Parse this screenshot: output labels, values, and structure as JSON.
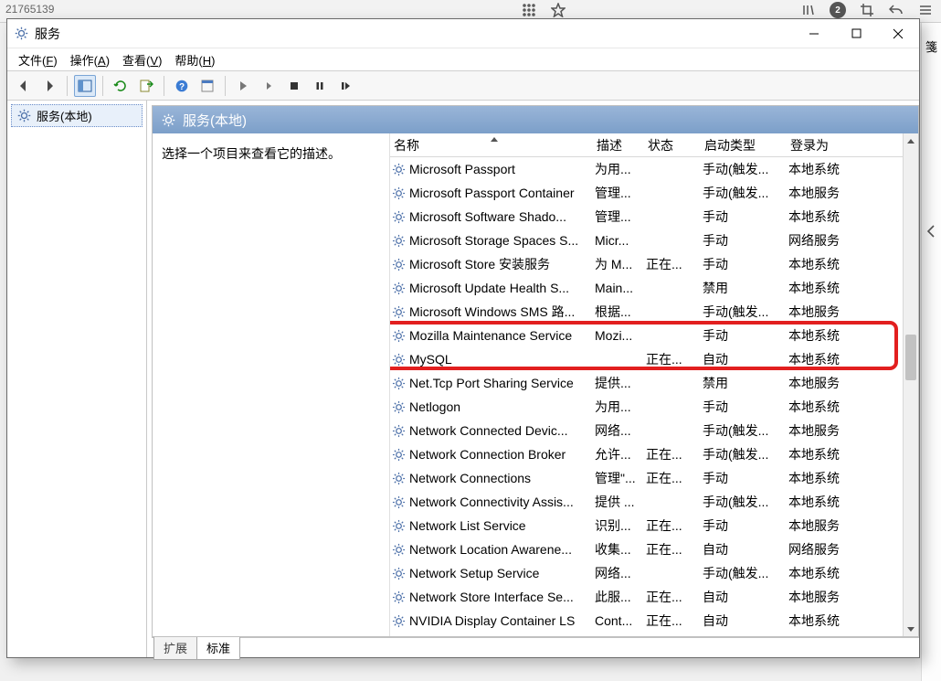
{
  "browser_bg": {
    "address_fragment": "21765139",
    "toolbar_icons": [
      "grid-icon",
      "star-icon",
      "library-icon",
      "badge-2",
      "crop-icon",
      "undo-icon",
      "menu-icon"
    ],
    "badge_value": "2",
    "right_strip": {
      "bookmark_glyph": "箋",
      "chevron": "‹"
    }
  },
  "window": {
    "title": "服务",
    "controls": {
      "min": "—",
      "max": "□",
      "close": "×"
    }
  },
  "menubar": [
    {
      "label": "文件",
      "hotkey": "F"
    },
    {
      "label": "操作",
      "hotkey": "A"
    },
    {
      "label": "查看",
      "hotkey": "V"
    },
    {
      "label": "帮助",
      "hotkey": "H"
    }
  ],
  "tree": {
    "root": "服务(本地)"
  },
  "content": {
    "header": "服务(本地)",
    "desc_prompt": "选择一个项目来查看它的描述。"
  },
  "columns": {
    "name": "名称",
    "desc": "描述",
    "status": "状态",
    "startup": "启动类型",
    "logon": "登录为"
  },
  "services": [
    {
      "name": "Microsoft Passport",
      "desc": "为用...",
      "status": "",
      "startup": "手动(触发...",
      "logon": "本地系统"
    },
    {
      "name": "Microsoft Passport Container",
      "desc": "管理...",
      "status": "",
      "startup": "手动(触发...",
      "logon": "本地服务"
    },
    {
      "name": "Microsoft Software Shado...",
      "desc": "管理...",
      "status": "",
      "startup": "手动",
      "logon": "本地系统"
    },
    {
      "name": "Microsoft Storage Spaces S...",
      "desc": "Micr...",
      "status": "",
      "startup": "手动",
      "logon": "网络服务"
    },
    {
      "name": "Microsoft Store 安装服务",
      "desc": "为 M...",
      "status": "正在...",
      "startup": "手动",
      "logon": "本地系统"
    },
    {
      "name": "Microsoft Update Health S...",
      "desc": "Main...",
      "status": "",
      "startup": "禁用",
      "logon": "本地系统"
    },
    {
      "name": "Microsoft Windows SMS 路...",
      "desc": "根据...",
      "status": "",
      "startup": "手动(触发...",
      "logon": "本地服务"
    },
    {
      "name": "Mozilla Maintenance Service",
      "desc": "Mozi...",
      "status": "",
      "startup": "手动",
      "logon": "本地系统"
    },
    {
      "name": "MySQL",
      "desc": "",
      "status": "正在...",
      "startup": "自动",
      "logon": "本地系统"
    },
    {
      "name": "Net.Tcp Port Sharing Service",
      "desc": "提供...",
      "status": "",
      "startup": "禁用",
      "logon": "本地服务"
    },
    {
      "name": "Netlogon",
      "desc": "为用...",
      "status": "",
      "startup": "手动",
      "logon": "本地系统"
    },
    {
      "name": "Network Connected Devic...",
      "desc": "网络...",
      "status": "",
      "startup": "手动(触发...",
      "logon": "本地服务"
    },
    {
      "name": "Network Connection Broker",
      "desc": "允许...",
      "status": "正在...",
      "startup": "手动(触发...",
      "logon": "本地系统"
    },
    {
      "name": "Network Connections",
      "desc": "管理\"...",
      "status": "正在...",
      "startup": "手动",
      "logon": "本地系统"
    },
    {
      "name": "Network Connectivity Assis...",
      "desc": "提供 ...",
      "status": "",
      "startup": "手动(触发...",
      "logon": "本地系统"
    },
    {
      "name": "Network List Service",
      "desc": "识别...",
      "status": "正在...",
      "startup": "手动",
      "logon": "本地服务"
    },
    {
      "name": "Network Location Awarene...",
      "desc": "收集...",
      "status": "正在...",
      "startup": "自动",
      "logon": "网络服务"
    },
    {
      "name": "Network Setup Service",
      "desc": "网络...",
      "status": "",
      "startup": "手动(触发...",
      "logon": "本地系统"
    },
    {
      "name": "Network Store Interface Se...",
      "desc": "此服...",
      "status": "正在...",
      "startup": "自动",
      "logon": "本地服务"
    },
    {
      "name": "NVIDIA Display Container LS",
      "desc": "Cont...",
      "status": "正在...",
      "startup": "自动",
      "logon": "本地系统"
    }
  ],
  "tabs": {
    "extended": "扩展",
    "standard": "标准"
  },
  "highlight": {
    "top_row_index": 7,
    "height_rows": 2
  }
}
